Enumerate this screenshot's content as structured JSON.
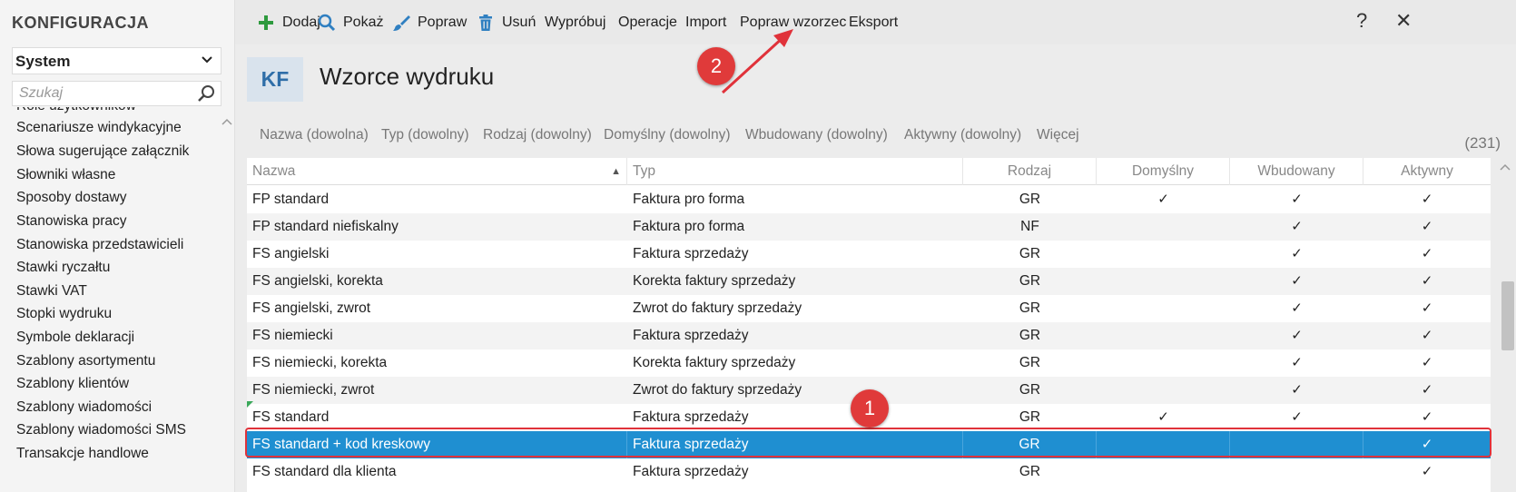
{
  "sidebar": {
    "title": "KONFIGURACJA",
    "module_select": "System",
    "search_placeholder": "Szukaj",
    "items": [
      "Role użytkowników",
      "Scenariusze windykacyjne",
      "Słowa sugerujące załącznik",
      "Słowniki własne",
      "Sposoby dostawy",
      "Stanowiska pracy",
      "Stanowiska przedstawicieli",
      "Stawki ryczałtu",
      "Stawki VAT",
      "Stopki wydruku",
      "Symbole deklaracji",
      "Szablony asortymentu",
      "Szablony klientów",
      "Szablony wiadomości",
      "Szablony wiadomości SMS",
      "Transakcje handlowe"
    ]
  },
  "toolbar": {
    "dodaj": "Dodaj",
    "pokaz": "Pokaż",
    "popraw": "Popraw",
    "usun": "Usuń",
    "wyprobuj": "Wypróbuj",
    "operacje": "Operacje",
    "import": "Import",
    "popraw_wzorzec": "Popraw wzorzec",
    "eksport": "Eksport",
    "help": "?",
    "close": "✕"
  },
  "header": {
    "badge": "KF",
    "title": "Wzorce wydruku"
  },
  "filters": [
    "Nazwa (dowolna)",
    "Typ (dowolny)",
    "Rodzaj (dowolny)",
    "Domyślny (dowolny)",
    "Wbudowany (dowolny)",
    "Aktywny (dowolny)",
    "Więcej"
  ],
  "record_count": "(231)",
  "table": {
    "columns": {
      "nazwa": "Nazwa",
      "typ": "Typ",
      "rodzaj": "Rodzaj",
      "domyslny": "Domyślny",
      "wbudowany": "Wbudowany",
      "aktywny": "Aktywny"
    },
    "check_glyph": "✓",
    "rows": [
      {
        "nazwa": "FP standard",
        "typ": "Faktura pro forma",
        "rodzaj": "GR",
        "domyslny": true,
        "wbudowany": true,
        "aktywny": true
      },
      {
        "nazwa": "FP standard niefiskalny",
        "typ": "Faktura pro forma",
        "rodzaj": "NF",
        "domyslny": false,
        "wbudowany": true,
        "aktywny": true
      },
      {
        "nazwa": "FS angielski",
        "typ": "Faktura sprzedaży",
        "rodzaj": "GR",
        "domyslny": false,
        "wbudowany": true,
        "aktywny": true
      },
      {
        "nazwa": "FS angielski, korekta",
        "typ": "Korekta faktury sprzedaży",
        "rodzaj": "GR",
        "domyslny": false,
        "wbudowany": true,
        "aktywny": true
      },
      {
        "nazwa": "FS angielski, zwrot",
        "typ": "Zwrot do faktury sprzedaży",
        "rodzaj": "GR",
        "domyslny": false,
        "wbudowany": true,
        "aktywny": true
      },
      {
        "nazwa": "FS niemiecki",
        "typ": "Faktura sprzedaży",
        "rodzaj": "GR",
        "domyslny": false,
        "wbudowany": true,
        "aktywny": true
      },
      {
        "nazwa": "FS niemiecki, korekta",
        "typ": "Korekta faktury sprzedaży",
        "rodzaj": "GR",
        "domyslny": false,
        "wbudowany": true,
        "aktywny": true
      },
      {
        "nazwa": "FS niemiecki, zwrot",
        "typ": "Zwrot do faktury sprzedaży",
        "rodzaj": "GR",
        "domyslny": false,
        "wbudowany": true,
        "aktywny": true
      },
      {
        "nazwa": "FS standard",
        "typ": "Faktura sprzedaży",
        "rodzaj": "GR",
        "domyslny": true,
        "wbudowany": true,
        "aktywny": true
      },
      {
        "nazwa": "FS standard + kod kreskowy",
        "typ": "Faktura sprzedaży",
        "rodzaj": "GR",
        "domyslny": false,
        "wbudowany": false,
        "aktywny": true,
        "selected": true
      },
      {
        "nazwa": "FS standard dla klienta",
        "typ": "Faktura sprzedaży",
        "rodzaj": "GR",
        "domyslny": false,
        "wbudowany": false,
        "aktywny": true
      }
    ]
  },
  "annotations": {
    "marker_1": "1",
    "marker_2": "2"
  },
  "colors": {
    "selected_row": "#1f8fd1",
    "annotation_red": "#e03a3a",
    "add_icon_green": "#2e9a3e",
    "toolbar_icon_blue": "#2f7fc1"
  }
}
